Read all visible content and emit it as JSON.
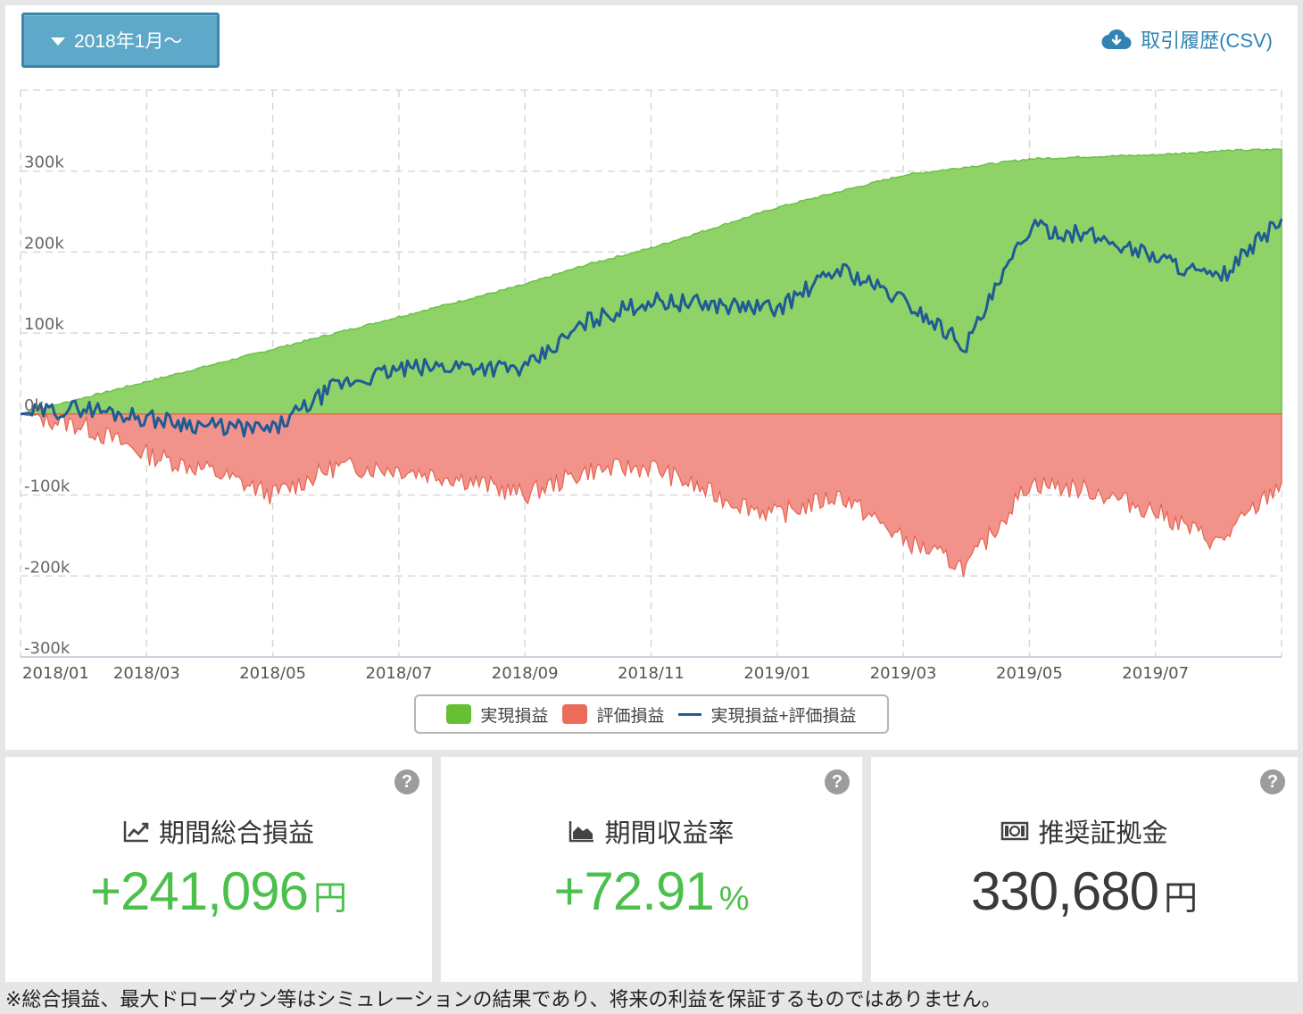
{
  "toolbar": {
    "period_label": "2018年1月〜",
    "csv_label": "取引履歴(CSV)"
  },
  "colors": {
    "realized": "#6cc04a",
    "unrealized": "#ee7a6c",
    "total": "#1f5b95",
    "positive": "#4cc04c"
  },
  "chart_data": {
    "type": "area",
    "x_unit": "month",
    "xlim": [
      "2018/01",
      "2019/08"
    ],
    "ylim": [
      -300000,
      400000
    ],
    "grid": true,
    "legend_position": "bottom",
    "x_ticks": [
      "2018/01",
      "2018/03",
      "2018/05",
      "2018/07",
      "2018/09",
      "2018/11",
      "2019/01",
      "2019/03",
      "2019/05",
      "2019/07"
    ],
    "y_ticks": [
      {
        "value": 300000,
        "label": "300k"
      },
      {
        "value": 200000,
        "label": "200k"
      },
      {
        "value": 100000,
        "label": "100k"
      },
      {
        "value": 0,
        "label": "0k"
      },
      {
        "value": -100000,
        "label": "-100k"
      },
      {
        "value": -200000,
        "label": "-200k"
      },
      {
        "value": -300000,
        "label": "-300k"
      }
    ],
    "series": [
      {
        "name": "実現損益",
        "kind": "area",
        "points": [
          [
            "2018/01",
            0
          ],
          [
            "2018/02",
            20000
          ],
          [
            "2018/03",
            40000
          ],
          [
            "2018/04",
            60000
          ],
          [
            "2018/05",
            80000
          ],
          [
            "2018/06",
            100000
          ],
          [
            "2018/07",
            120000
          ],
          [
            "2018/08",
            140000
          ],
          [
            "2018/09",
            160000
          ],
          [
            "2018/10",
            185000
          ],
          [
            "2018/11",
            205000
          ],
          [
            "2018/12",
            230000
          ],
          [
            "2019/01",
            255000
          ],
          [
            "2019/02",
            275000
          ],
          [
            "2019/03",
            295000
          ],
          [
            "2019/04",
            305000
          ],
          [
            "2019/05",
            315000
          ],
          [
            "2019/06",
            318000
          ],
          [
            "2019/07",
            320000
          ],
          [
            "2019/08",
            325000
          ],
          [
            "2019/08/31",
            327000
          ]
        ]
      },
      {
        "name": "評価損益",
        "kind": "area",
        "points": [
          [
            "2018/01",
            0
          ],
          [
            "2018/02",
            -15000
          ],
          [
            "2018/03",
            -50000
          ],
          [
            "2018/04",
            -70000
          ],
          [
            "2018/05",
            -100000
          ],
          [
            "2018/06",
            -65000
          ],
          [
            "2018/07",
            -68000
          ],
          [
            "2018/08",
            -80000
          ],
          [
            "2018/09",
            -100000
          ],
          [
            "2018/10",
            -70000
          ],
          [
            "2018/11",
            -65000
          ],
          [
            "2018/12",
            -100000
          ],
          [
            "2019/01",
            -125000
          ],
          [
            "2019/02",
            -100000
          ],
          [
            "2019/03",
            -155000
          ],
          [
            "2019/04",
            -190000
          ],
          [
            "2019/05",
            -85000
          ],
          [
            "2019/06",
            -95000
          ],
          [
            "2019/07",
            -120000
          ],
          [
            "2019/08",
            -160000
          ],
          [
            "2019/08/31",
            -85000
          ]
        ]
      },
      {
        "name": "実現損益+評価損益",
        "kind": "line",
        "points": [
          [
            "2018/01",
            0
          ],
          [
            "2018/02",
            8000
          ],
          [
            "2018/03",
            -5000
          ],
          [
            "2018/04",
            -15000
          ],
          [
            "2018/05",
            -20000
          ],
          [
            "2018/06",
            35000
          ],
          [
            "2018/07",
            55000
          ],
          [
            "2018/08",
            60000
          ],
          [
            "2018/09",
            55000
          ],
          [
            "2018/10",
            115000
          ],
          [
            "2018/11",
            140000
          ],
          [
            "2018/12",
            135000
          ],
          [
            "2019/01",
            130000
          ],
          [
            "2019/02",
            180000
          ],
          [
            "2019/03",
            140000
          ],
          [
            "2019/04",
            85000
          ],
          [
            "2019/05",
            230000
          ],
          [
            "2019/06",
            220000
          ],
          [
            "2019/07",
            195000
          ],
          [
            "2019/08",
            165000
          ],
          [
            "2019/08/31",
            241096
          ]
        ]
      }
    ]
  },
  "stats": [
    {
      "title": "期間総合損益",
      "value": "+241,096",
      "unit": "円",
      "help": "?"
    },
    {
      "title": "期間収益率",
      "value": "+72.91",
      "unit": "%",
      "help": "?"
    },
    {
      "title": "推奨証拠金",
      "value": "330,680",
      "unit": "円",
      "help": "?"
    }
  ],
  "footnote": "※総合損益、最大ドローダウン等はシミュレーションの結果であり、将来の利益を保証するものではありません。"
}
